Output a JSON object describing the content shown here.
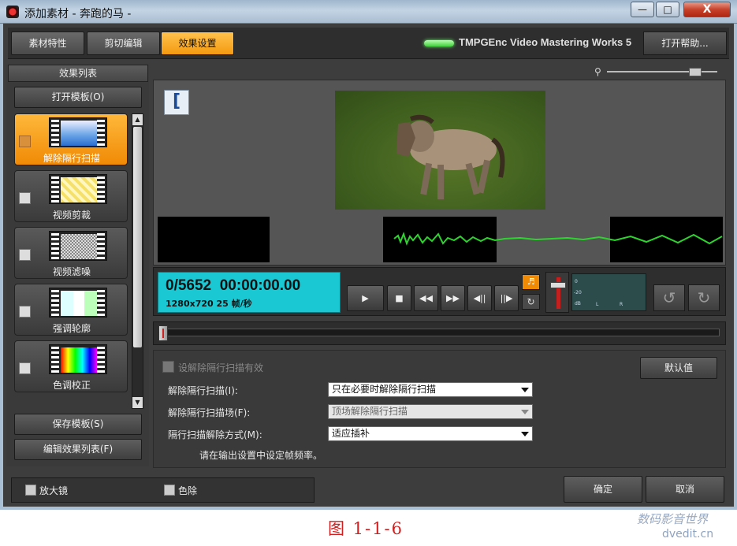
{
  "window": {
    "title": "添加素材 - 奔跑的马 -",
    "minimize": "—",
    "maximize": "□",
    "close": "X"
  },
  "tabs": [
    {
      "label": "素材特性"
    },
    {
      "label": "剪切编辑"
    },
    {
      "label": "效果设置",
      "active": true
    }
  ],
  "brand": "TMPGEnc Video Mastering Works 5",
  "help_button": "打开帮助...",
  "left_panel": {
    "header": "效果列表",
    "open_template": "打开模板(O)",
    "effects": [
      {
        "name": "解除隔行扫描",
        "selected": true,
        "icon": "deinterlace-icon"
      },
      {
        "name": "视频剪裁",
        "selected": false,
        "icon": "video-crop-icon"
      },
      {
        "name": "视频滤噪",
        "selected": false,
        "icon": "noise-filter-icon"
      },
      {
        "name": "强调轮廓",
        "selected": false,
        "icon": "sharpen-edge-icon"
      },
      {
        "name": "色调校正",
        "selected": false,
        "icon": "color-correction-icon"
      }
    ],
    "save_template": "保存模板(S)",
    "edit_effect_list": "编辑效果列表(F)"
  },
  "preview": {
    "crop_icon": "[",
    "zoom_icon": "magnifier-icon"
  },
  "transport": {
    "frame_counter": "0/5652",
    "timecode": "00:00:00.00",
    "info": "1280x720 25 帧/秒",
    "buttons": {
      "play": "▶",
      "stop": "■",
      "rewind": "◀◀",
      "forward": "▶▶",
      "prev_frame": "◀||",
      "next_frame": "||▶"
    },
    "audio_icon": "speaker-icon",
    "loop_icon": "loop-icon",
    "meter": {
      "top": "0",
      "mid": "-20",
      "bottom": "dB",
      "l": "L",
      "r": "R"
    },
    "undo": "↺",
    "redo": "↻"
  },
  "settings": {
    "enable_deinterlace": "设解除隔行扫描有效",
    "default_button": "默认值",
    "rows": [
      {
        "label": "解除隔行扫描(I):",
        "value": "只在必要时解除隔行扫描",
        "disabled": false
      },
      {
        "label": "解除隔行扫描场(F):",
        "value": "顶场解除隔行扫描",
        "disabled": true
      },
      {
        "label": "隔行扫描解除方式(M):",
        "value": "适应插补",
        "disabled": false
      }
    ],
    "note": "请在输出设置中设定帧频率。"
  },
  "bottom": {
    "magnifier": "放大镜",
    "color_removal": "色除",
    "ok": "确定",
    "cancel": "取消"
  },
  "caption": "图 1-1-6",
  "watermark": "数码影音世界",
  "watermark_url": "dvedit.cn",
  "colors": {
    "accent_orange": "#f49a10",
    "timecode_cyan": "#19c8d3",
    "panel_dark": "#3a3a3a",
    "wave_green": "#2fd32f"
  }
}
